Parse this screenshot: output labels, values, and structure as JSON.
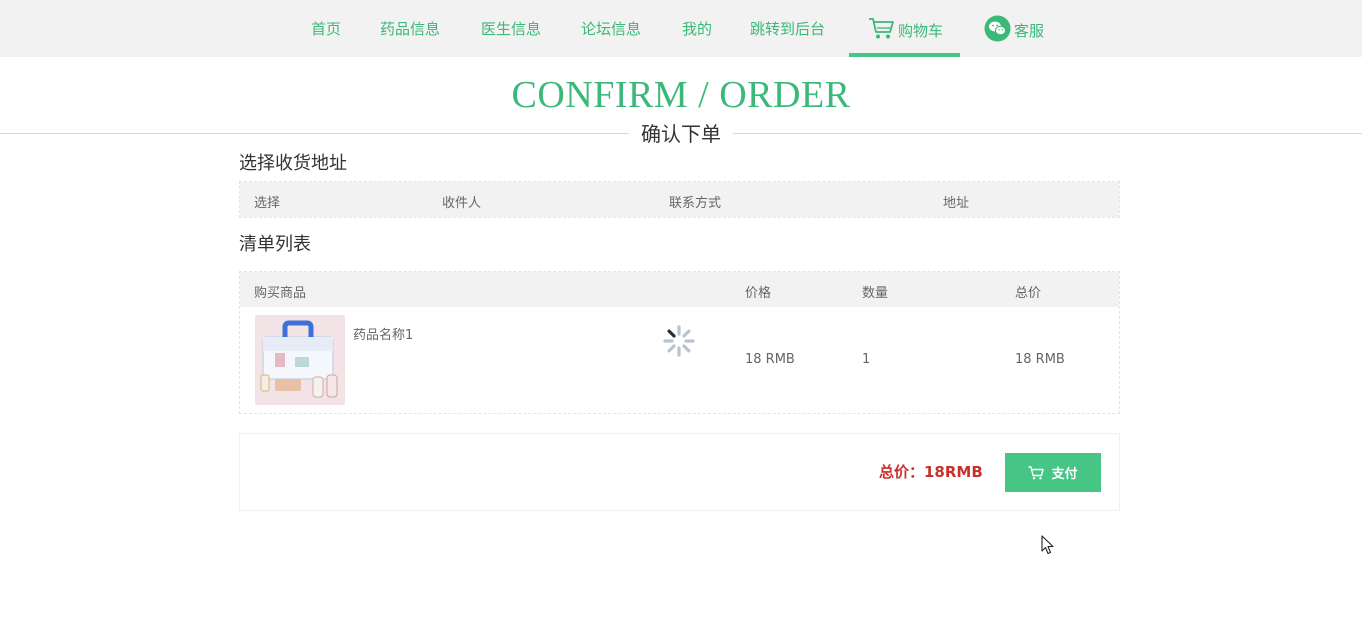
{
  "nav": {
    "items": [
      {
        "label": "首页"
      },
      {
        "label": "药品信息"
      },
      {
        "label": "医生信息"
      },
      {
        "label": "论坛信息"
      },
      {
        "label": "我的"
      },
      {
        "label": "跳转到后台"
      },
      {
        "label": "购物车",
        "icon": "cart-icon",
        "active": true
      },
      {
        "label": "客服",
        "icon": "wechat-icon"
      }
    ]
  },
  "hero": {
    "title": "CONFIRM / ORDER",
    "subtitle": "确认下单"
  },
  "address_section": {
    "title": "选择收货地址",
    "columns": [
      "选择",
      "收件人",
      "联系方式",
      "地址"
    ]
  },
  "list_section": {
    "title": "清单列表",
    "columns": [
      "购买商品",
      "价格",
      "数量",
      "总价"
    ],
    "rows": [
      {
        "name": "药品名称1",
        "price": "18 RMB",
        "quantity": "1",
        "total": "18 RMB",
        "image": "medicine-box-image"
      }
    ]
  },
  "summary": {
    "total_label": "总价：18RMB",
    "pay_label": "支付"
  },
  "colors": {
    "accent": "#47c584",
    "nav_text": "#3cb878",
    "total_text": "#c9302c",
    "header_bg": "#f2f2f2"
  }
}
